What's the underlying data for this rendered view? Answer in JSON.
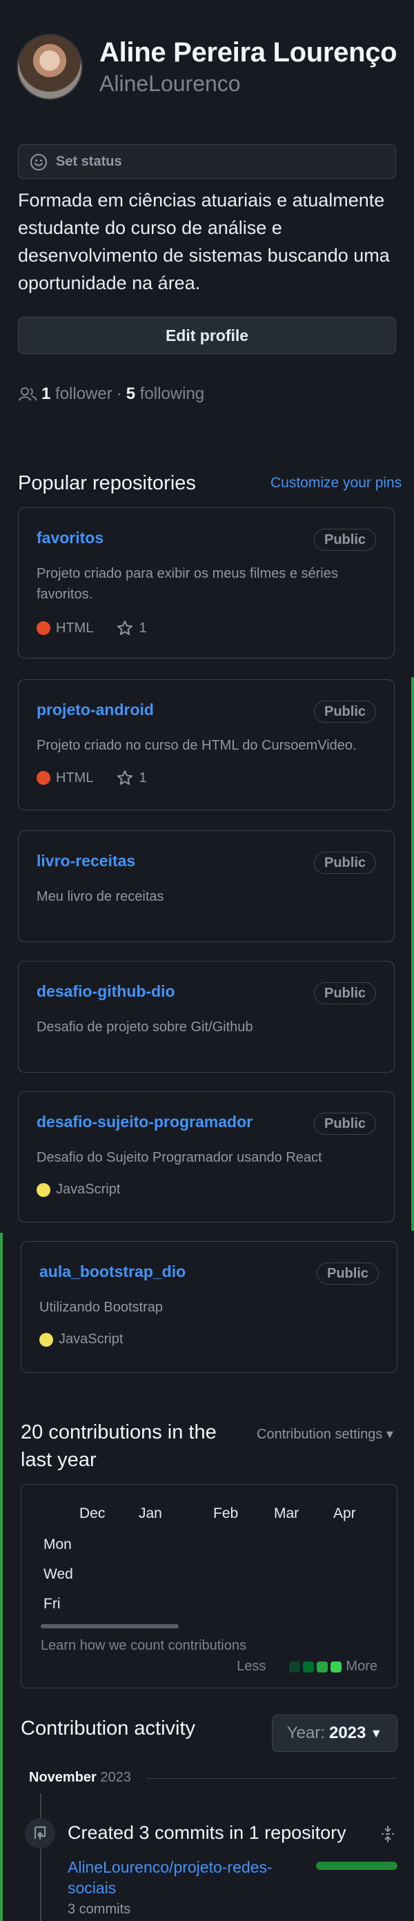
{
  "profile": {
    "name": "Aline Pereira Lourenço",
    "login": "AlineLourenco",
    "status_label": "Set status",
    "bio": "Formada em ciências atuariais e atualmente estudante do curso de análise e desenvolvimento de sistemas buscando uma oportunidade na área.",
    "edit_label": "Edit profile",
    "followers": "1",
    "followers_label": "follower",
    "separator": "·",
    "following": "5",
    "following_label": "following"
  },
  "repos": {
    "title": "Popular repositories",
    "customize": "Customize your pins",
    "items": [
      {
        "name": "favoritos",
        "visibility": "Public",
        "description": "Projeto criado para exibir os meus filmes e séries favoritos.",
        "language": "HTML",
        "lang_color": "#e34c26",
        "stars": "1"
      },
      {
        "name": "projeto-android",
        "visibility": "Public",
        "description": "Projeto criado no curso de HTML do CursoemVideo.",
        "language": "HTML",
        "lang_color": "#e34c26",
        "stars": "1"
      },
      {
        "name": "livro-receitas",
        "visibility": "Public",
        "description": "Meu livro de receitas"
      },
      {
        "name": "desafio-github-dio",
        "visibility": "Public",
        "description": "Desafio de projeto sobre Git/Github"
      },
      {
        "name": "desafio-sujeito-programador",
        "visibility": "Public",
        "description": "Desafio do Sujeito Programador usando React",
        "language": "JavaScript",
        "lang_color": "#f1e05a"
      },
      {
        "name": "aula_bootstrap_dio",
        "visibility": "Public",
        "description": "Utilizando Bootstrap",
        "language": "JavaScript",
        "lang_color": "#f1e05a"
      }
    ]
  },
  "contributions": {
    "title": "20 contributions in the last year",
    "settings": "Contribution settings",
    "months": [
      "Dec",
      "Jan",
      "Feb",
      "Mar",
      "Apr"
    ],
    "days": [
      "Mon",
      "Wed",
      "Fri"
    ],
    "learn": "Learn how we count contributions",
    "less": "Less",
    "more": "More",
    "legend_colors": [
      "#0e4429",
      "#006d32",
      "#26a641",
      "#39d353"
    ]
  },
  "activity": {
    "title": "Contribution activity",
    "year_prefix": "Year:",
    "year": "2023",
    "month": "November",
    "month_year": "2023",
    "commit_title": "Created 3 commits in 1 repository",
    "commit_repo": "AlineLourenco/projeto-redes-sociais",
    "commit_count": "3 commits"
  },
  "colors": {
    "background": "#171b21",
    "accent": "#4493f8",
    "green": "#2ea043"
  }
}
